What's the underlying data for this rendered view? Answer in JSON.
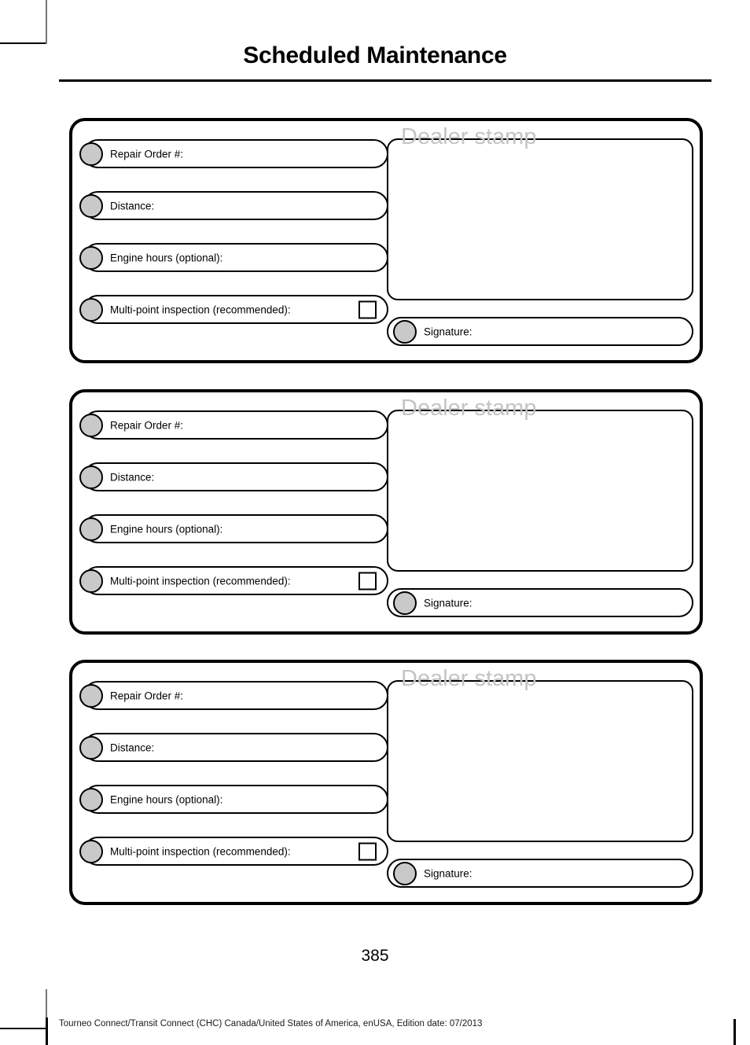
{
  "document": {
    "title": "Scheduled Maintenance",
    "page_number": "385",
    "footer": "Tourneo Connect/Transit Connect (CHC) Canada/United States of America, enUSA, Edition date: 07/2013"
  },
  "field_labels": {
    "repair_order": "Repair Order #:",
    "distance": "Distance:",
    "engine_hours": "Engine hours (optional):",
    "multipoint": "Multi-point inspection (recommended):",
    "signature": "Signature:",
    "dealer_stamp": "Dealer stamp"
  },
  "colors": {
    "bullet_fill": "#c9c9c9",
    "stamp_text": "#c4c4c4",
    "border": "#000000"
  },
  "records": [
    {
      "fields": [
        {
          "label": "Repair Order #:",
          "value": "",
          "checkbox": false
        },
        {
          "label": "Distance:",
          "value": "",
          "checkbox": false
        },
        {
          "label": "Engine hours (optional):",
          "value": "",
          "checkbox": false
        },
        {
          "label": "Multi-point inspection (recommended):",
          "value": "",
          "checkbox": true
        }
      ],
      "stamp_label": "Dealer stamp",
      "stamp_value": "",
      "signature_label": "Signature:",
      "signature_value": ""
    },
    {
      "fields": [
        {
          "label": "Repair Order #:",
          "value": "",
          "checkbox": false
        },
        {
          "label": "Distance:",
          "value": "",
          "checkbox": false
        },
        {
          "label": "Engine hours (optional):",
          "value": "",
          "checkbox": false
        },
        {
          "label": "Multi-point inspection (recommended):",
          "value": "",
          "checkbox": true
        }
      ],
      "stamp_label": "Dealer stamp",
      "stamp_value": "",
      "signature_label": "Signature:",
      "signature_value": ""
    },
    {
      "fields": [
        {
          "label": "Repair Order #:",
          "value": "",
          "checkbox": false
        },
        {
          "label": "Distance:",
          "value": "",
          "checkbox": false
        },
        {
          "label": "Engine hours (optional):",
          "value": "",
          "checkbox": false
        },
        {
          "label": "Multi-point inspection (recommended):",
          "value": "",
          "checkbox": true
        }
      ],
      "stamp_label": "Dealer stamp",
      "stamp_value": "",
      "signature_label": "Signature:",
      "signature_value": ""
    }
  ]
}
